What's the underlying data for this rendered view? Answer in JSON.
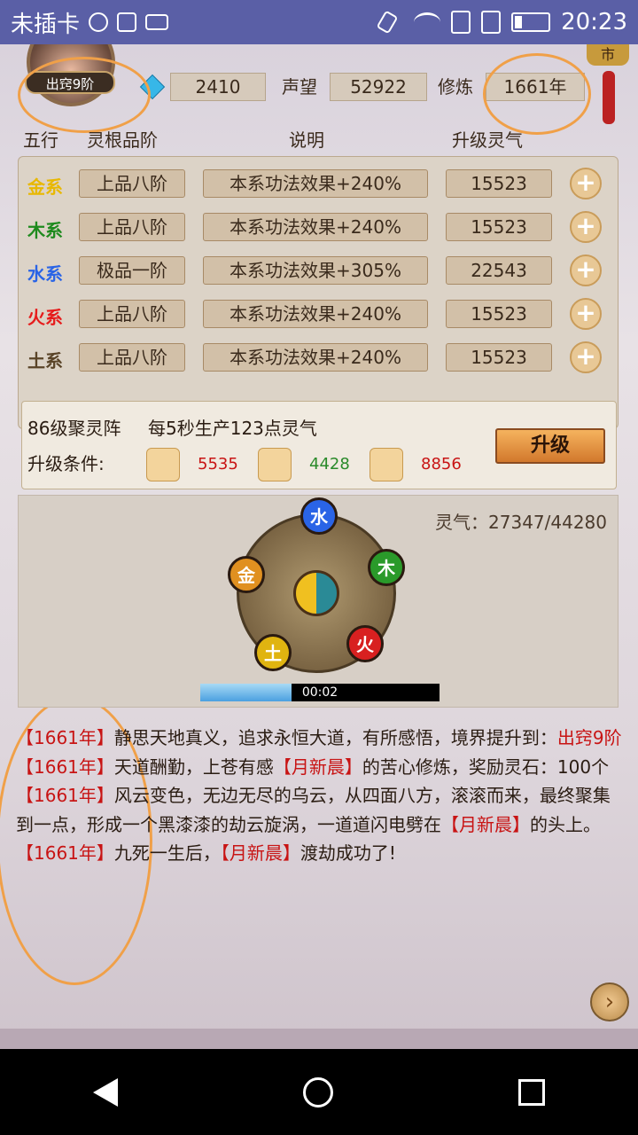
{
  "status_bar": {
    "carrier": "未插卡",
    "time": "20:23"
  },
  "top": {
    "rank_badge": "出窍9阶",
    "stone": "2410",
    "prestige_label": "声望",
    "prestige": "52922",
    "cultivation_label": "修炼",
    "cultivation": "1661年",
    "shop_label": "市"
  },
  "elements": {
    "headers": {
      "wuxing": "五行",
      "grade": "灵根品阶",
      "desc": "说明",
      "cost": "升级灵气"
    },
    "rows": [
      {
        "name": "金系",
        "color": "#e8b800",
        "grade": "上品八阶",
        "desc": "本系功法效果+240%",
        "cost": "15523"
      },
      {
        "name": "木系",
        "color": "#1e8a1e",
        "grade": "上品八阶",
        "desc": "本系功法效果+240%",
        "cost": "15523"
      },
      {
        "name": "水系",
        "color": "#2a64e6",
        "grade": "极品一阶",
        "desc": "本系功法效果+305%",
        "cost": "22543"
      },
      {
        "name": "火系",
        "color": "#e61c1c",
        "grade": "上品八阶",
        "desc": "本系功法效果+240%",
        "cost": "15523"
      },
      {
        "name": "土系",
        "color": "#5a4428",
        "grade": "上品八阶",
        "desc": "本系功法效果+240%",
        "cost": "15523"
      }
    ],
    "plus_symbol": "+"
  },
  "array": {
    "title": "86级聚灵阵",
    "production": "每5秒生产123点灵气",
    "cond_label": "升级条件:",
    "resources": [
      {
        "icon": "stone-icon",
        "value": "5535",
        "color": "#c81414"
      },
      {
        "icon": "wood-icon",
        "value": "4428",
        "color": "#2a8a2a"
      },
      {
        "icon": "herb-icon",
        "value": "8856",
        "color": "#c81414"
      }
    ],
    "upgrade_label": "升级"
  },
  "formation": {
    "lingqi": "灵气：27347/44280",
    "nodes": {
      "water": "水",
      "wood": "木",
      "fire": "火",
      "earth": "土",
      "metal": "金"
    },
    "progress_fraction": 0.38,
    "progress_time": "00:02"
  },
  "log": [
    {
      "year": "【1661年】",
      "text1": "静思天地真义，追求永恒大道，有所感悟，境界提升到：",
      "name": "出窍9阶",
      "text2": ""
    },
    {
      "year": "【1661年】",
      "text1": "天道酬勤，上苍有感",
      "name": "【月新晨】",
      "text2": "的苦心修炼，奖励灵石：100个"
    },
    {
      "year": "【1661年】",
      "text1": "风云变色，无边无尽的乌云，从四面八方，滚滚而来，最终聚集到一点，形成一个黑漆漆的劫云旋涡，一道道闪电劈在",
      "name": "【月新晨】",
      "text2": "的头上。"
    },
    {
      "year": "【1661年】",
      "text1": "九死一生后，",
      "name": "【月新晨】",
      "text2": "渡劫成功了!"
    }
  ]
}
